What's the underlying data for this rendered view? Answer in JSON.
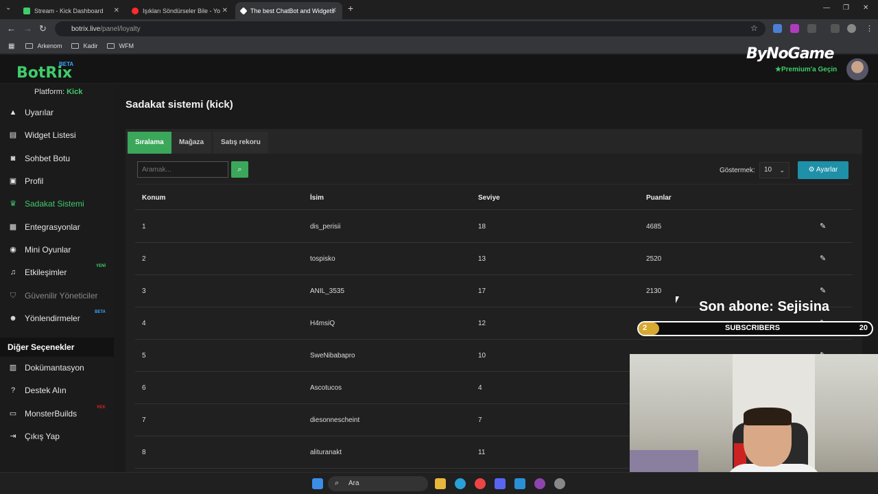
{
  "browser": {
    "tabs": [
      {
        "label": "Stream - Kick Dashboard",
        "fav_color": "#3fcc6b"
      },
      {
        "label": "Işıkları Söndürseler Bile - Yo",
        "fav_color": "#ff2b2b"
      },
      {
        "label": "The best ChatBot and Widgets",
        "fav_color": "#ffffff"
      }
    ],
    "url_host": "botrix.live",
    "url_path": "/panel/loyalty",
    "bookmarks": [
      "Arkenom",
      "Kadir",
      "WFM"
    ]
  },
  "header": {
    "logo": "BotRix",
    "logo_badge": "BETA",
    "sponsor": "ByNoGame",
    "premium": "Premium'a Geçin"
  },
  "sidebar": {
    "platform_label": "Platform:",
    "platform_value": "Kick",
    "items": [
      {
        "label": "Uyarılar",
        "icon": "warning-icon"
      },
      {
        "label": "Widget Listesi",
        "icon": "grid-icon"
      },
      {
        "label": "Sohbet Botu",
        "icon": "robot-icon"
      },
      {
        "label": "Profil",
        "icon": "id-card-icon"
      },
      {
        "label": "Sadakat Sistemi",
        "icon": "trophy-icon"
      },
      {
        "label": "Entegrasyonlar",
        "icon": "puzzle-icon"
      },
      {
        "label": "Mini Oyunlar",
        "icon": "gamepad-icon"
      },
      {
        "label": "Etkileşimler",
        "icon": "music-icon",
        "badge": "YENİ"
      },
      {
        "label": "Güvenilir Yöneticiler",
        "icon": "shield-icon"
      },
      {
        "label": "Yönlendirmeler",
        "icon": "users-icon",
        "badge": "BETA"
      }
    ],
    "other_title": "Diğer Seçenekler",
    "other_items": [
      {
        "label": "Dokümantasyon",
        "icon": "book-icon"
      },
      {
        "label": "Destek Alın",
        "icon": "question-icon"
      },
      {
        "label": "MonsterBuilds",
        "icon": "laptop-icon",
        "badge": "REK"
      },
      {
        "label": "Çıkış Yap",
        "icon": "logout-icon"
      }
    ]
  },
  "main": {
    "title": "Sadakat sistemi (kick)",
    "tabs": [
      "Sıralama",
      "Mağaza",
      "Satış rekoru"
    ],
    "search_placeholder": "Aramak...",
    "show_label": "Göstermek:",
    "show_value": "10",
    "settings_label": "Ayarlar",
    "columns": [
      "Konum",
      "İsim",
      "Seviye",
      "Puanlar"
    ],
    "rows": [
      {
        "pos": "1",
        "name": "dis_perisii",
        "level": "18",
        "points": "4685"
      },
      {
        "pos": "2",
        "name": "tospisko",
        "level": "13",
        "points": "2520"
      },
      {
        "pos": "3",
        "name": "ANIL_3535",
        "level": "17",
        "points": "2130"
      },
      {
        "pos": "4",
        "name": "H4msiQ",
        "level": "12",
        "points": ""
      },
      {
        "pos": "5",
        "name": "SweNibabapro",
        "level": "10",
        "points": ""
      },
      {
        "pos": "6",
        "name": "Ascotucos",
        "level": "4",
        "points": ""
      },
      {
        "pos": "7",
        "name": "diesonnescheint",
        "level": "7",
        "points": ""
      },
      {
        "pos": "8",
        "name": "alituranakt",
        "level": "11",
        "points": ""
      }
    ]
  },
  "overlay": {
    "last_sub": "Son abone: Sejisina",
    "sub_count": "2",
    "sub_label": "SUBSCRIBERS",
    "sub_goal": "20"
  },
  "taskbar": {
    "search_label": "Ara"
  }
}
